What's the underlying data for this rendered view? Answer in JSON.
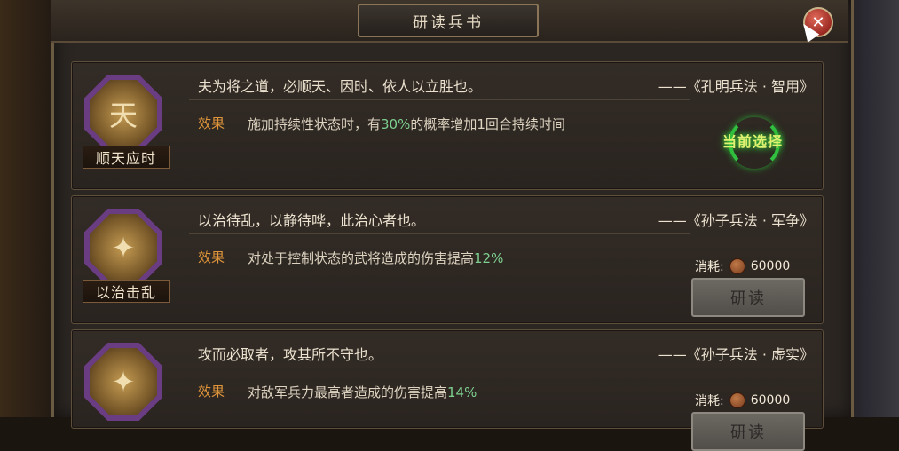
{
  "title": "研读兵书",
  "close_symbol": "✕",
  "current_selected_label": "当前选择",
  "cost_label": "消耗:",
  "study_button_label": "研读",
  "effect_label": "效果",
  "accent_colors": {
    "effect_label": "#e0953a",
    "highlight": "#7dd090",
    "selected_glow": "#32c040"
  },
  "books": [
    {
      "name": "顺天应时",
      "icon": "banner-icon",
      "icon_glyph": "天",
      "quote": "夫为将之道，必顺天、因时、依人以立胜也。",
      "source": "——《孔明兵法 · 智用》",
      "effect_pre": "施加持续性状态时，有",
      "effect_value": "30%",
      "effect_post": "的概率增加1回合持续时间",
      "status": "selected"
    },
    {
      "name": "以治击乱",
      "icon": "warrior-icon",
      "icon_glyph": "✦",
      "quote": "以治待乱，以静待哗，此治心者也。",
      "source": "——《孙子兵法 · 军争》",
      "effect_pre": "对处于控制状态的武将造成的伤害提高",
      "effect_value": "12%",
      "effect_post": "",
      "cost": "60000",
      "status": "available"
    },
    {
      "name": "",
      "icon": "soldier-icon",
      "icon_glyph": "✦",
      "quote": "攻而必取者，攻其所不守也。",
      "source": "——《孙子兵法 · 虚实》",
      "effect_pre": "对敌军兵力最高者造成的伤害提高",
      "effect_value": "14%",
      "effect_post": "",
      "cost": "60000",
      "status": "available"
    }
  ]
}
